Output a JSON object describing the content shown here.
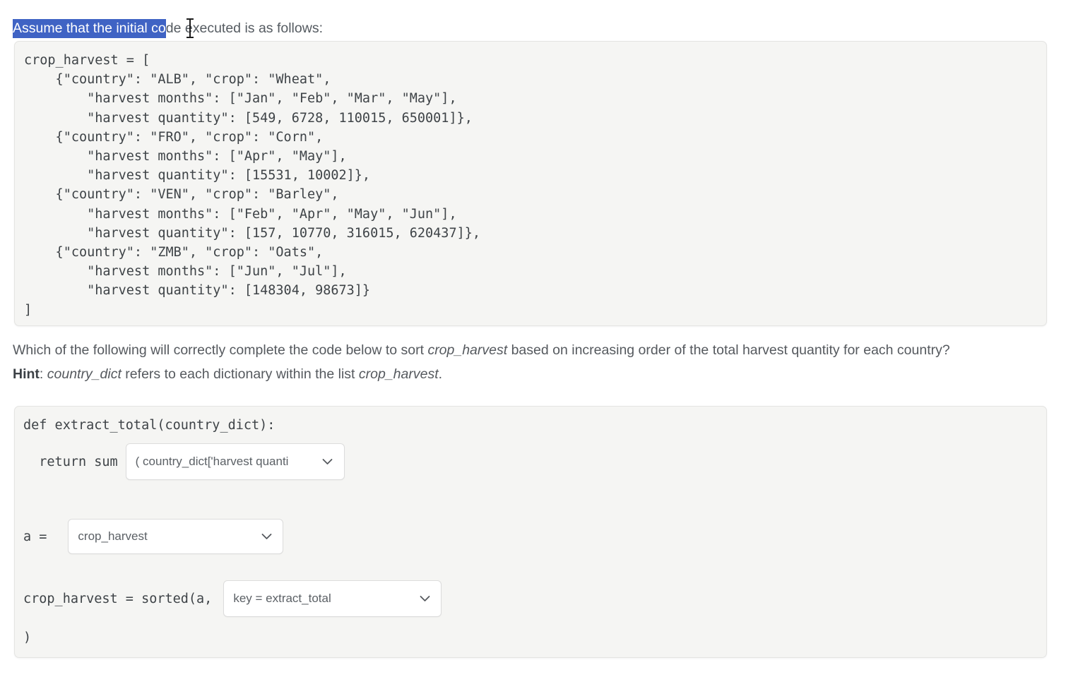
{
  "prompt": {
    "selected_text": "Assume that the initial co",
    "rest_text": "de executed is as follows:",
    "selection_color": "#3f63c4",
    "caret": "text-cursor"
  },
  "initial_code_block": {
    "code": "crop_harvest = [\n    {\"country\": \"ALB\", \"crop\": \"Wheat\",\n        \"harvest months\": [\"Jan\", \"Feb\", \"Mar\", \"May\"],\n        \"harvest quantity\": [549, 6728, 110015, 650001]},\n    {\"country\": \"FRO\", \"crop\": \"Corn\",\n        \"harvest months\": [\"Apr\", \"May\"],\n        \"harvest quantity\": [15531, 10002]},\n    {\"country\": \"VEN\", \"crop\": \"Barley\",\n        \"harvest months\": [\"Feb\", \"Apr\", \"May\", \"Jun\"],\n        \"harvest quantity\": [157, 10770, 316015, 620437]},\n    {\"country\": \"ZMB\", \"crop\": \"Oats\",\n        \"harvest months\": [\"Jun\", \"Jul\"],\n        \"harvest quantity\": [148304, 98673]}\n]"
  },
  "question": {
    "line1_a": "Which of the following will correctly complete the code below to sort ",
    "line1_em": "crop_harvest",
    "line1_b": " based on increasing order of the total harvest quantity for each country?",
    "hint_label": "Hint",
    "hint_sep": ": ",
    "hint_em1": "country_dict",
    "hint_mid": " refers to each dictionary within the list ",
    "hint_em2": "crop_harvest",
    "hint_end": "."
  },
  "answer_code_block": {
    "line_def": "def extract_total(country_dict):",
    "line_return": "  return sum",
    "line_a": "a =",
    "line_sorted": "crop_harvest = sorted(a,",
    "line_close": ")",
    "dropdowns": {
      "return_expr": {
        "value": "( country_dict['harvest quanti",
        "full_value": "( country_dict['harvest quantity'] )"
      },
      "list_source": {
        "value": "crop_harvest"
      },
      "sort_key": {
        "value": "key = extract_total"
      }
    }
  }
}
